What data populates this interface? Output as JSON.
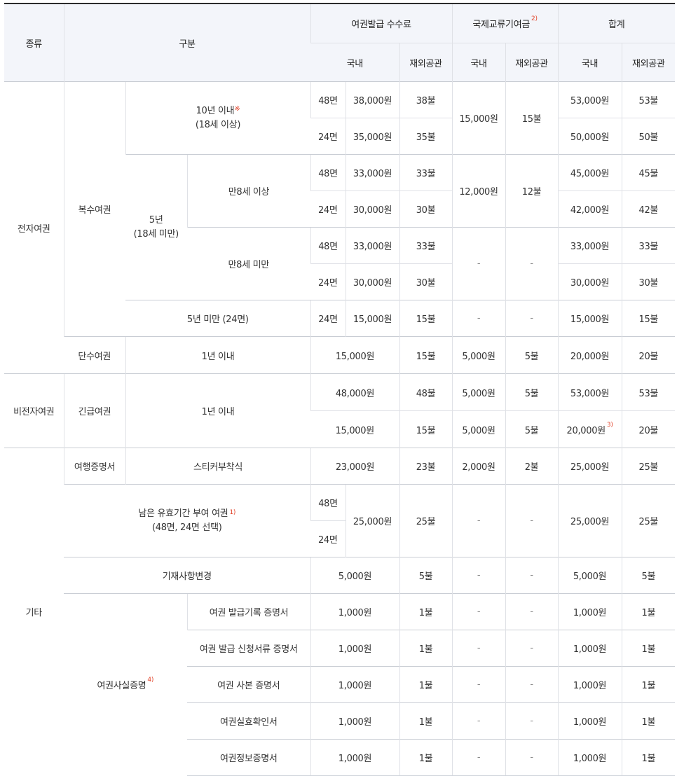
{
  "header": {
    "type": "종류",
    "category": "구분",
    "issue_fee": "여권발급 수수료",
    "intl_fund": "국제교류기여금",
    "intl_fund_note": "2)",
    "total": "합계",
    "domestic": "국내",
    "overseas": "재외공관"
  },
  "common": {
    "dash": "-",
    "p48": "48면",
    "p24": "24면"
  },
  "sections": {
    "epassport": "전자여권",
    "non_epassport": "비전자여권",
    "other": "기타"
  },
  "labels": {
    "multiple": "복수여권",
    "ten_years": "10년 이내",
    "ten_years_mark": "※",
    "ten_years_sub": "(18세 이상)",
    "five_years": "5년",
    "five_years_sub": "(18세 미만)",
    "over8": "만8세 이상",
    "under8": "만8세 미만",
    "under5": "5년 미만 (24면)",
    "single": "단수여권",
    "within1": "1년 이내",
    "emergency": "긴급여권",
    "travel_cert": "여행증명서",
    "sticker": "스티커부착식",
    "remaining": "남은 유효기간 부여 여권",
    "remaining_note": "1)",
    "remaining_sub": "(48면, 24면 선택)",
    "change": "기재사항변경",
    "fact_cert": "여권사실증명",
    "fact_cert_note": "4)",
    "cert1": "여권 발급기록 증명서",
    "cert2": "여권 발급 신청서류 증명서",
    "cert3": "여권 사본 증명서",
    "cert4": "여권실효확인서",
    "cert5": "여권정보증명서"
  },
  "rows": {
    "r10y48": {
      "fee": "38,000원",
      "fee_o": "38불",
      "total": "53,000원",
      "total_o": "53불"
    },
    "r10y24": {
      "fee": "35,000원",
      "fee_o": "35불",
      "total": "50,000원",
      "total_o": "50불"
    },
    "r10y_fund": {
      "d": "15,000원",
      "o": "15불"
    },
    "o8_48": {
      "fee": "33,000원",
      "fee_o": "33불",
      "total": "45,000원",
      "total_o": "45불"
    },
    "o8_24": {
      "fee": "30,000원",
      "fee_o": "30불",
      "total": "42,000원",
      "total_o": "42불"
    },
    "o8_fund": {
      "d": "12,000원",
      "o": "12불"
    },
    "u8_48": {
      "fee": "33,000원",
      "fee_o": "33불",
      "total": "33,000원",
      "total_o": "33불"
    },
    "u8_24": {
      "fee": "30,000원",
      "fee_o": "30불",
      "total": "30,000원",
      "total_o": "30불"
    },
    "u5": {
      "fee": "15,000원",
      "fee_o": "15불",
      "total": "15,000원",
      "total_o": "15불"
    },
    "single": {
      "fee": "15,000원",
      "fee_o": "15불",
      "fund": "5,000원",
      "fund_o": "5불",
      "total": "20,000원",
      "total_o": "20불"
    },
    "emg1": {
      "fee": "48,000원",
      "fee_o": "48불",
      "fund": "5,000원",
      "fund_o": "5불",
      "total": "53,000원",
      "total_o": "53불"
    },
    "emg2": {
      "fee": "15,000원",
      "fee_o": "15불",
      "fund": "5,000원",
      "fund_o": "5불",
      "total": "20,000원",
      "total_note": "3)",
      "total_o": "20불"
    },
    "travel": {
      "fee": "23,000원",
      "fee_o": "23불",
      "fund": "2,000원",
      "fund_o": "2불",
      "total": "25,000원",
      "total_o": "25불"
    },
    "remaining": {
      "fee": "25,000원",
      "fee_o": "25불",
      "total": "25,000원",
      "total_o": "25불"
    },
    "change": {
      "fee": "5,000원",
      "fee_o": "5불",
      "total": "5,000원",
      "total_o": "5불"
    },
    "cert": {
      "fee": "1,000원",
      "fee_o": "1불",
      "total": "1,000원",
      "total_o": "1불"
    }
  }
}
